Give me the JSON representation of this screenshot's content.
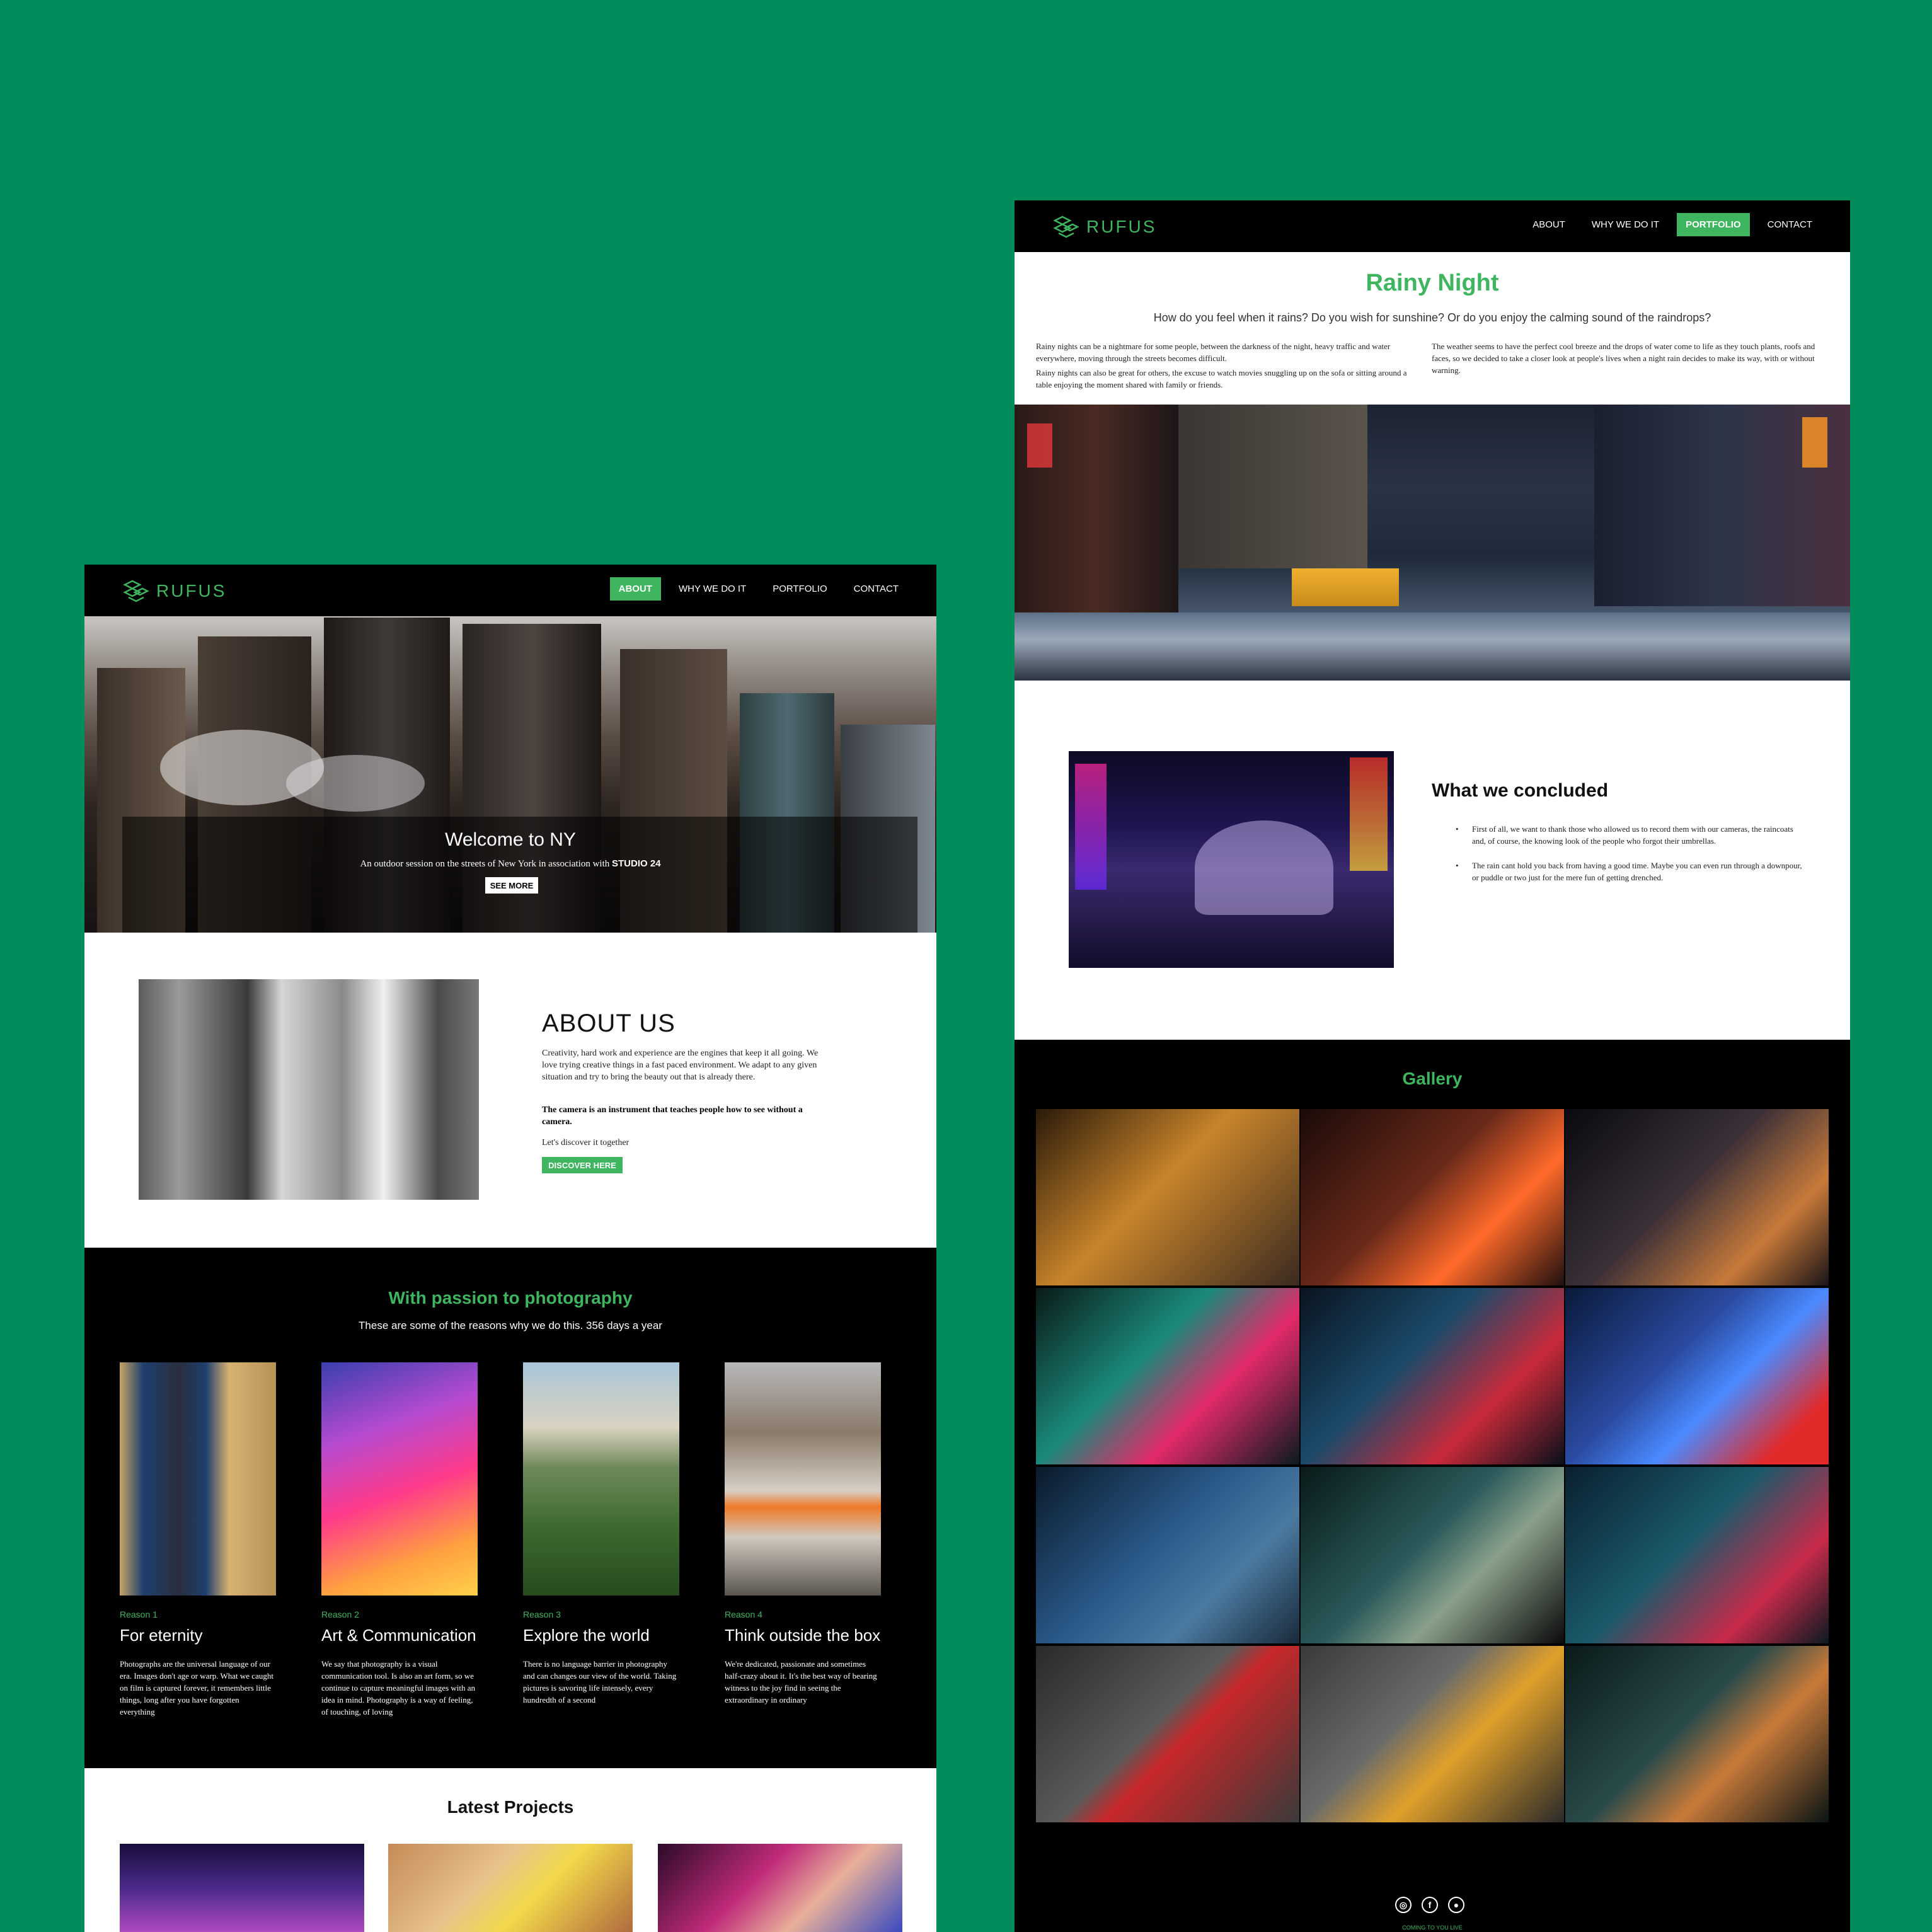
{
  "left": {
    "nav": {
      "logo": "RUFUS",
      "items": [
        {
          "label": "ABOUT",
          "active": true
        },
        {
          "label": "WHY WE DO IT",
          "active": false
        },
        {
          "label": "PORTFOLIO",
          "active": false
        },
        {
          "label": "CONTACT",
          "active": false
        }
      ]
    },
    "hero": {
      "title": "Welcome to NY",
      "subtitle": "An outdoor session on the streets of New York in association with",
      "subtitle_bold": "STUDIO 24",
      "button": "SEE MORE"
    },
    "about": {
      "title": "ABOUT US",
      "paragraph": "Creativity, hard work and experience are the engines that keep it all going. We love trying creative things in a fast paced environment. We adapt to any given situation and try to bring the beauty out that is already there.",
      "strong": "The camera is an instrument that teaches people how to see without a camera.",
      "link": "Let's discover it together",
      "button": "DISCOVER HERE"
    },
    "reasons": {
      "title": "With passion to photography",
      "subtitle": "These are some of the reasons why we do this. 356 days a year",
      "cards": [
        {
          "reason": "Reason 1",
          "title": "For eternity",
          "text": "Photographs are the universal language of our era. Images don't age or warp. What we caught on film is captured forever, it remembers little things, long after you have forgotten everything"
        },
        {
          "reason": "Reason 2",
          "title": "Art & Communication",
          "text": "We say that photography is a visual communication tool. Is also an art form, so we continue to capture meaningful images with an idea in mind. Photography is a way of feeling, of touching, of loving"
        },
        {
          "reason": "Reason 3",
          "title": "Explore the world",
          "text": "There is no language barrier in photography and can changes our view of the world. Taking pictures is savoring life intensely, every hundredth of a second"
        },
        {
          "reason": "Reason 4",
          "title": "Think outside the box",
          "text": "We're dedicated, passionate and sometimes half-crazy about it. It's the best way of bearing witness to the joy find in seeing the extraordinary in ordinary"
        }
      ]
    },
    "latest": {
      "title": "Latest Projects"
    }
  },
  "right": {
    "nav": {
      "logo": "RUFUS",
      "items": [
        {
          "label": "ABOUT",
          "active": false
        },
        {
          "label": "WHY WE DO IT",
          "active": false
        },
        {
          "label": "PORTFOLIO",
          "active": true
        },
        {
          "label": "CONTACT",
          "active": false
        }
      ]
    },
    "title": "Rainy Night",
    "subtitle": "How do you feel when it rains? Do you wish for sunshine? Or do you enjoy the calming sound of the raindrops?",
    "col1": [
      "Rainy nights can be a nightmare for some people, between the darkness of the night, heavy traffic and water everywhere, moving through the streets becomes difficult.",
      "Rainy nights can also be great for others, the excuse to watch movies snuggling up on the sofa or sitting around a table enjoying the moment shared with family or friends."
    ],
    "col2": [
      "The weather seems to have the perfect cool breeze and the drops of water come to life as they touch plants, roofs and faces, so we decided to take a closer look at people's lives when a night rain decides to make its way, with or without warning."
    ],
    "concluded": {
      "title": "What we concluded",
      "items": [
        "First of all, we want to thank those who allowed us to record them with our cameras, the raincoats and, of course, the knowing look of the people who forgot their umbrellas.",
        "The rain cant hold you back from having a good time. Maybe you can even run through a downpour, or puddle or two just for the mere fun of getting drenched."
      ]
    },
    "gallery": {
      "title": "Gallery"
    },
    "footer": {
      "note": "COMING TO YOU LIVE"
    }
  },
  "colors": {
    "background": "#008c5b",
    "accent": "#3fb55f",
    "nav": "#000000"
  },
  "icons": [
    "logo-icon",
    "instagram-icon",
    "facebook-icon",
    "camera-icon",
    "bullet-icon"
  ]
}
